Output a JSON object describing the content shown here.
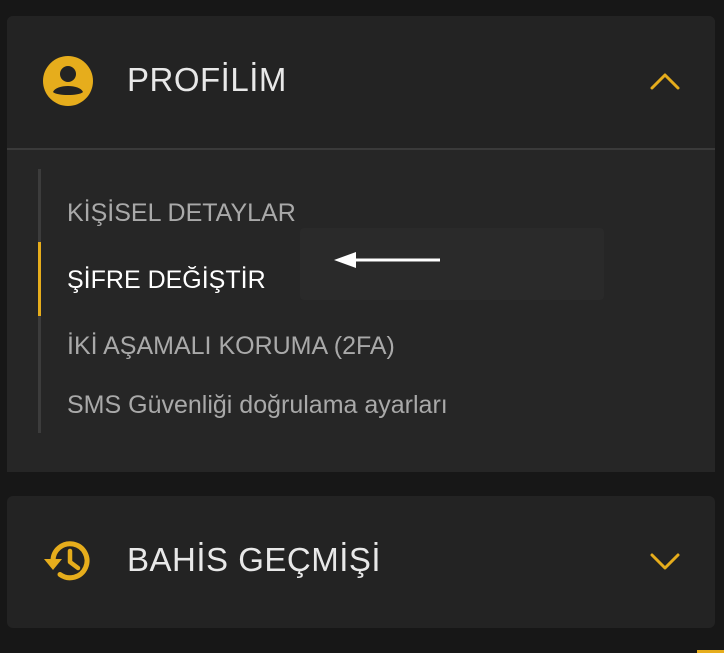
{
  "colors": {
    "accent": "#e6ad1c",
    "panel_bg": "#232323",
    "page_bg": "#171717",
    "text_primary": "#e8e8e8",
    "text_muted": "#a9a9a9",
    "text_active": "#ffffff"
  },
  "profile_section": {
    "title": "PROFİLİM",
    "icon": "user-circle-icon",
    "state_icon": "chevron-up-icon",
    "items": [
      {
        "label": "KİŞİSEL DETAYLAR",
        "active": false
      },
      {
        "label": "ŞİFRE DEĞİŞTİR",
        "active": true
      },
      {
        "label": "İKİ AŞAMALI KORUMA (2FA)",
        "active": false
      },
      {
        "label": "SMS Güvenliği doğrulama ayarları",
        "active": false
      }
    ],
    "annotation_icon": "arrow-left-icon"
  },
  "history_section": {
    "title": "BAHİS GEÇMİŞİ",
    "icon": "history-icon",
    "state_icon": "chevron-down-icon"
  }
}
